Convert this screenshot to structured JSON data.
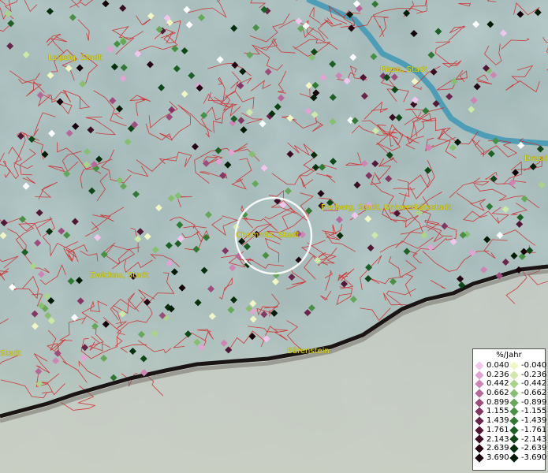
{
  "places": [
    {
      "name": "Leipzig, Stadt"
    },
    {
      "name": "Riesa, Stadt"
    },
    {
      "name": "Dresd"
    },
    {
      "name": "Freiberg, Stadt, Universitätsstadt"
    },
    {
      "name": "Chemnitz, Stadt"
    },
    {
      "name": "Zwickau, Stadt"
    },
    {
      "name": "Bärenstein"
    },
    {
      "name": "Stadt"
    }
  ],
  "legend": {
    "title": "%/Jahr",
    "positive": [
      {
        "value": "0.040",
        "color": "#f2c6ec"
      },
      {
        "value": "0.236",
        "color": "#e3a3d3"
      },
      {
        "value": "0.442",
        "color": "#cf84b6"
      },
      {
        "value": "0.662",
        "color": "#b8679a"
      },
      {
        "value": "0.899",
        "color": "#9e4c7e"
      },
      {
        "value": "1.155",
        "color": "#853664"
      },
      {
        "value": "1.439",
        "color": "#6b244b"
      },
      {
        "value": "1.761",
        "color": "#531635"
      },
      {
        "value": "2.143",
        "color": "#3d0b22"
      },
      {
        "value": "2.639",
        "color": "#270412"
      },
      {
        "value": "3.690",
        "color": "#140006"
      }
    ],
    "negative": [
      {
        "value": "-0.040",
        "color": "#f0f7c2"
      },
      {
        "value": "-0.236",
        "color": "#cde9a4"
      },
      {
        "value": "-0.442",
        "color": "#a9d589"
      },
      {
        "value": "-0.662",
        "color": "#86c06f"
      },
      {
        "value": "-0.899",
        "color": "#64a957"
      },
      {
        "value": "-1.155",
        "color": "#479142"
      },
      {
        "value": "-1.439",
        "color": "#2f7a31"
      },
      {
        "value": "-1.761",
        "color": "#1c6123"
      },
      {
        "value": "-2.143",
        "color": "#0e4816"
      },
      {
        "value": "-2.639",
        "color": "#06300c"
      },
      {
        "value": "-3.690",
        "color": "#011a05"
      }
    ]
  }
}
